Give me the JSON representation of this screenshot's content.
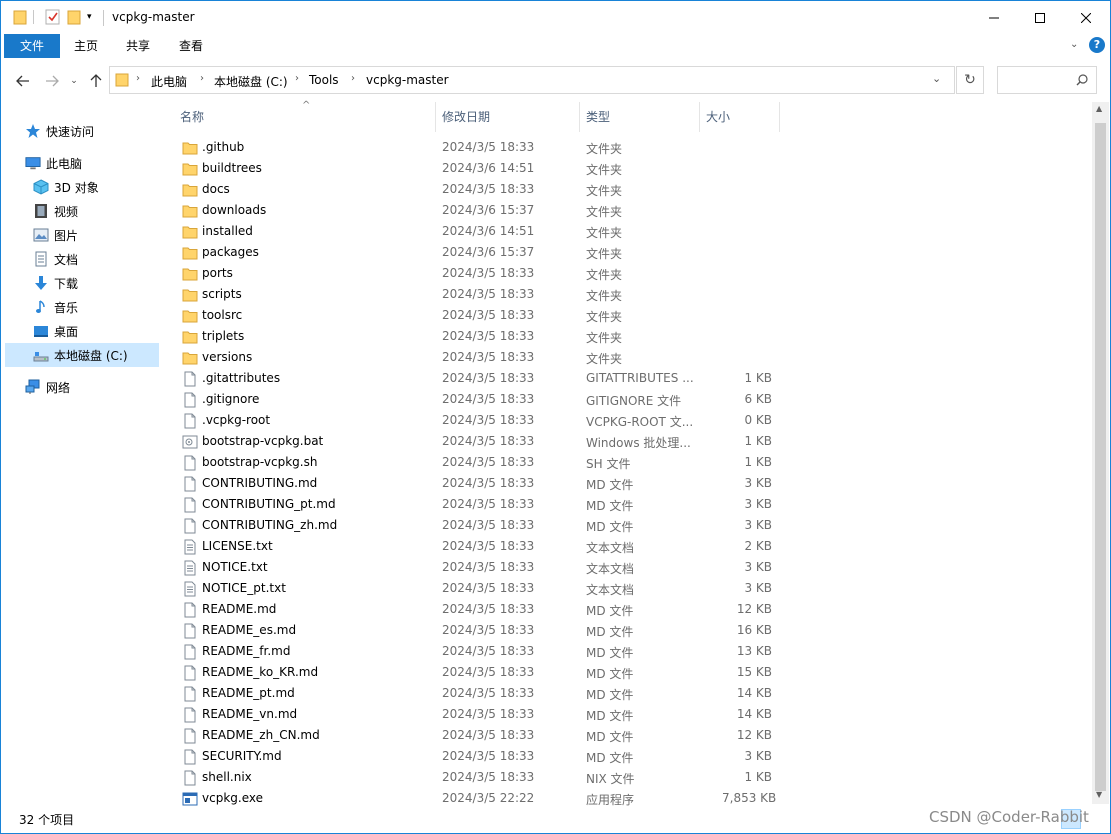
{
  "window": {
    "title": "vcpkg-master",
    "accent": "#1979ca"
  },
  "ribbon": {
    "tabs": [
      "文件",
      "主页",
      "共享",
      "查看"
    ]
  },
  "address": {
    "crumbs": [
      "此电脑",
      "本地磁盘 (C:)",
      "Tools",
      "vcpkg-master"
    ]
  },
  "search": {
    "placeholder": ""
  },
  "navpane": {
    "quick_access": "快速访问",
    "this_pc": "此电脑",
    "items": [
      "3D 对象",
      "视频",
      "图片",
      "文档",
      "下载",
      "音乐",
      "桌面",
      "本地磁盘 (C:)"
    ],
    "network": "网络"
  },
  "columns": {
    "name": "名称",
    "date": "修改日期",
    "type": "类型",
    "size": "大小"
  },
  "files": [
    {
      "name": ".github",
      "date": "2024/3/5 18:33",
      "type": "文件夹",
      "size": "",
      "icon": "folder-icon"
    },
    {
      "name": "buildtrees",
      "date": "2024/3/6 14:51",
      "type": "文件夹",
      "size": "",
      "icon": "folder-icon"
    },
    {
      "name": "docs",
      "date": "2024/3/5 18:33",
      "type": "文件夹",
      "size": "",
      "icon": "folder-icon"
    },
    {
      "name": "downloads",
      "date": "2024/3/6 15:37",
      "type": "文件夹",
      "size": "",
      "icon": "folder-icon"
    },
    {
      "name": "installed",
      "date": "2024/3/6 14:51",
      "type": "文件夹",
      "size": "",
      "icon": "folder-icon"
    },
    {
      "name": "packages",
      "date": "2024/3/6 15:37",
      "type": "文件夹",
      "size": "",
      "icon": "folder-icon"
    },
    {
      "name": "ports",
      "date": "2024/3/5 18:33",
      "type": "文件夹",
      "size": "",
      "icon": "folder-icon"
    },
    {
      "name": "scripts",
      "date": "2024/3/5 18:33",
      "type": "文件夹",
      "size": "",
      "icon": "folder-icon"
    },
    {
      "name": "toolsrc",
      "date": "2024/3/5 18:33",
      "type": "文件夹",
      "size": "",
      "icon": "folder-icon"
    },
    {
      "name": "triplets",
      "date": "2024/3/5 18:33",
      "type": "文件夹",
      "size": "",
      "icon": "folder-icon"
    },
    {
      "name": "versions",
      "date": "2024/3/5 18:33",
      "type": "文件夹",
      "size": "",
      "icon": "folder-icon"
    },
    {
      "name": ".gitattributes",
      "date": "2024/3/5 18:33",
      "type": "GITATTRIBUTES ...",
      "size": "1 KB",
      "icon": "file-icon"
    },
    {
      "name": ".gitignore",
      "date": "2024/3/5 18:33",
      "type": "GITIGNORE 文件",
      "size": "6 KB",
      "icon": "file-icon"
    },
    {
      "name": ".vcpkg-root",
      "date": "2024/3/5 18:33",
      "type": "VCPKG-ROOT 文...",
      "size": "0 KB",
      "icon": "file-icon"
    },
    {
      "name": "bootstrap-vcpkg.bat",
      "date": "2024/3/5 18:33",
      "type": "Windows 批处理...",
      "size": "1 KB",
      "icon": "batch-file-icon"
    },
    {
      "name": "bootstrap-vcpkg.sh",
      "date": "2024/3/5 18:33",
      "type": "SH 文件",
      "size": "1 KB",
      "icon": "file-icon"
    },
    {
      "name": "CONTRIBUTING.md",
      "date": "2024/3/5 18:33",
      "type": "MD 文件",
      "size": "3 KB",
      "icon": "file-icon"
    },
    {
      "name": "CONTRIBUTING_pt.md",
      "date": "2024/3/5 18:33",
      "type": "MD 文件",
      "size": "3 KB",
      "icon": "file-icon"
    },
    {
      "name": "CONTRIBUTING_zh.md",
      "date": "2024/3/5 18:33",
      "type": "MD 文件",
      "size": "3 KB",
      "icon": "file-icon"
    },
    {
      "name": "LICENSE.txt",
      "date": "2024/3/5 18:33",
      "type": "文本文档",
      "size": "2 KB",
      "icon": "text-file-icon"
    },
    {
      "name": "NOTICE.txt",
      "date": "2024/3/5 18:33",
      "type": "文本文档",
      "size": "3 KB",
      "icon": "text-file-icon"
    },
    {
      "name": "NOTICE_pt.txt",
      "date": "2024/3/5 18:33",
      "type": "文本文档",
      "size": "3 KB",
      "icon": "text-file-icon"
    },
    {
      "name": "README.md",
      "date": "2024/3/5 18:33",
      "type": "MD 文件",
      "size": "12 KB",
      "icon": "file-icon"
    },
    {
      "name": "README_es.md",
      "date": "2024/3/5 18:33",
      "type": "MD 文件",
      "size": "16 KB",
      "icon": "file-icon"
    },
    {
      "name": "README_fr.md",
      "date": "2024/3/5 18:33",
      "type": "MD 文件",
      "size": "13 KB",
      "icon": "file-icon"
    },
    {
      "name": "README_ko_KR.md",
      "date": "2024/3/5 18:33",
      "type": "MD 文件",
      "size": "15 KB",
      "icon": "file-icon"
    },
    {
      "name": "README_pt.md",
      "date": "2024/3/5 18:33",
      "type": "MD 文件",
      "size": "14 KB",
      "icon": "file-icon"
    },
    {
      "name": "README_vn.md",
      "date": "2024/3/5 18:33",
      "type": "MD 文件",
      "size": "14 KB",
      "icon": "file-icon"
    },
    {
      "name": "README_zh_CN.md",
      "date": "2024/3/5 18:33",
      "type": "MD 文件",
      "size": "12 KB",
      "icon": "file-icon"
    },
    {
      "name": "SECURITY.md",
      "date": "2024/3/5 18:33",
      "type": "MD 文件",
      "size": "3 KB",
      "icon": "file-icon"
    },
    {
      "name": "shell.nix",
      "date": "2024/3/5 18:33",
      "type": "NIX 文件",
      "size": "1 KB",
      "icon": "file-icon"
    },
    {
      "name": "vcpkg.exe",
      "date": "2024/3/5 22:22",
      "type": "应用程序",
      "size": "7,853 KB",
      "icon": "exe-icon"
    }
  ],
  "status": {
    "count": "32 个项目"
  },
  "watermark": "CSDN @Coder-Rabbit"
}
